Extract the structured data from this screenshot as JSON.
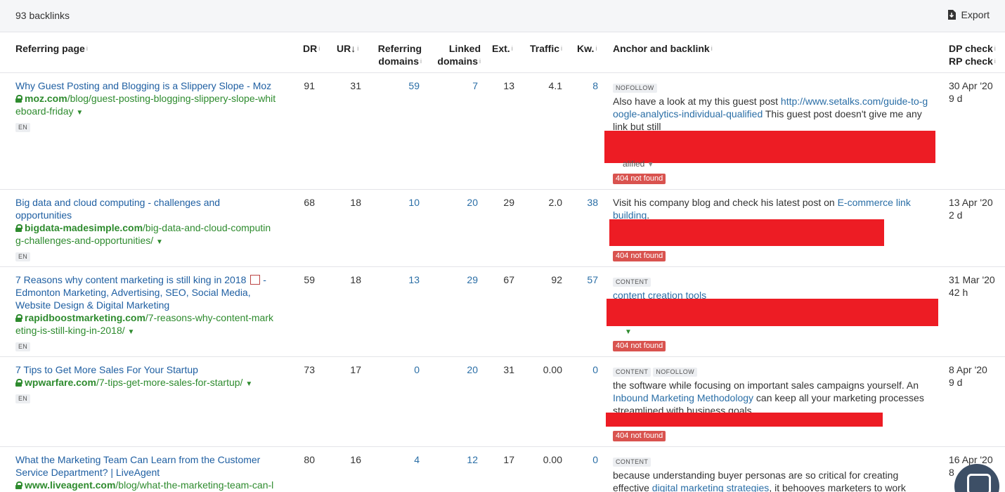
{
  "toolbar": {
    "count_label": "93 backlinks",
    "export_label": "Export"
  },
  "columns": {
    "referring_page": "Referring page",
    "dr": "DR",
    "ur": "UR",
    "ur_sort": "↓",
    "referring_domains_1": "Referring",
    "referring_domains_2": "domains",
    "linked_domains_1": "Linked",
    "linked_domains_2": "domains",
    "ext": "Ext.",
    "traffic": "Traffic",
    "kw": "Kw.",
    "anchor": "Anchor and backlink",
    "dp_check": "DP check",
    "rp_check": "RP check",
    "info": "i"
  },
  "rows": [
    {
      "title": "Why Guest Posting and Blogging is a Slippery Slope - Moz",
      "domain": "moz.com",
      "path1": "/blog/guest-posting-blogging-slippery-slope-whit",
      "path2": "eboard-friday",
      "lang": "EN",
      "dr": "91",
      "ur": "31",
      "ref_domains": "59",
      "linked_domains": "7",
      "ext": "13",
      "traffic": "4.1",
      "kw": "8",
      "tags": [
        "NOFOLLOW"
      ],
      "anchor_pre": "Also have a look at my this guest post ",
      "anchor_link": "http://www.setalks.com/guide-to-google-analytics-individual-qualified",
      "anchor_post": " This guest post doesn't give me any link but still",
      "anchor_under": "alified",
      "status": "404 not found",
      "dp": "30 Apr '20",
      "rp": "9 d"
    },
    {
      "title_1": "Big data and cloud computing - challenges and",
      "title_2": "opportunities",
      "domain": "bigdata-madesimple.com",
      "path1": "/big-data-and-cloud-computin",
      "path2": "g-challenges-and-opportunities/",
      "lang": "EN",
      "dr": "68",
      "ur": "18",
      "ref_domains": "10",
      "linked_domains": "20",
      "ext": "29",
      "traffic": "2.0",
      "kw": "38",
      "anchor_pre": "Visit his company blog and check his latest post on ",
      "anchor_link": "E-commerce link building",
      "anchor_post": ".",
      "status": "404 not found",
      "dp": "13 Apr '20",
      "rp": "2 d"
    },
    {
      "title_1": "7 Reasons why content marketing is still king in 2018",
      "title_1b": "-",
      "title_2": "Edmonton Marketing, Advertising, SEO, Social Media,",
      "title_3": "Website Design & Digital Marketing",
      "domain": "rapidboostmarketing.com",
      "path1": "/7-reasons-why-content-mark",
      "path2": "eting-is-still-king-in-2018/",
      "lang": "EN",
      "dr": "59",
      "ur": "18",
      "ref_domains": "13",
      "linked_domains": "29",
      "ext": "67",
      "traffic": "92",
      "kw": "57",
      "tags": [
        "CONTENT"
      ],
      "anchor_link": "content creation tools",
      "status": "404 not found",
      "dp": "31 Mar '20",
      "rp": "42 h"
    },
    {
      "title": "7 Tips to Get More Sales For Your Startup",
      "domain": "wpwarfare.com",
      "path1": "/7-tips-get-more-sales-for-startup/",
      "lang": "EN",
      "dr": "73",
      "ur": "17",
      "ref_domains": "0",
      "linked_domains": "20",
      "ext": "31",
      "traffic": "0.00",
      "kw": "0",
      "tags": [
        "CONTENT",
        "NOFOLLOW"
      ],
      "anchor_pre": "the software while focusing on important sales campaigns yourself. An ",
      "anchor_link": "Inbound Marketing Methodology",
      "anchor_post": " can keep all your marketing processes streamlined with business goals.",
      "status": "404 not found",
      "dp": "8 Apr '20",
      "rp": "9 d"
    },
    {
      "title_1": "What the Marketing Team Can Learn from the Customer",
      "title_2": "Service Department? | LiveAgent",
      "domain": "www.liveagent.com",
      "path1": "/blog/what-the-marketing-team-can-l",
      "dr": "80",
      "ur": "16",
      "ref_domains": "4",
      "linked_domains": "12",
      "ext": "17",
      "traffic": "0.00",
      "kw": "0",
      "tags": [
        "CONTENT"
      ],
      "anchor_pre": "because understanding buyer personas are so critical for creating effective ",
      "anchor_link": "digital marketing strategies",
      "anchor_post": ", it behooves marketers to work",
      "dp": "16 Apr '20",
      "rp": "8"
    }
  ],
  "colors": {
    "link": "#1f5fa2",
    "url_green": "#2e8b2e",
    "redaction": "#ed1c24",
    "error": "#d9534f"
  }
}
